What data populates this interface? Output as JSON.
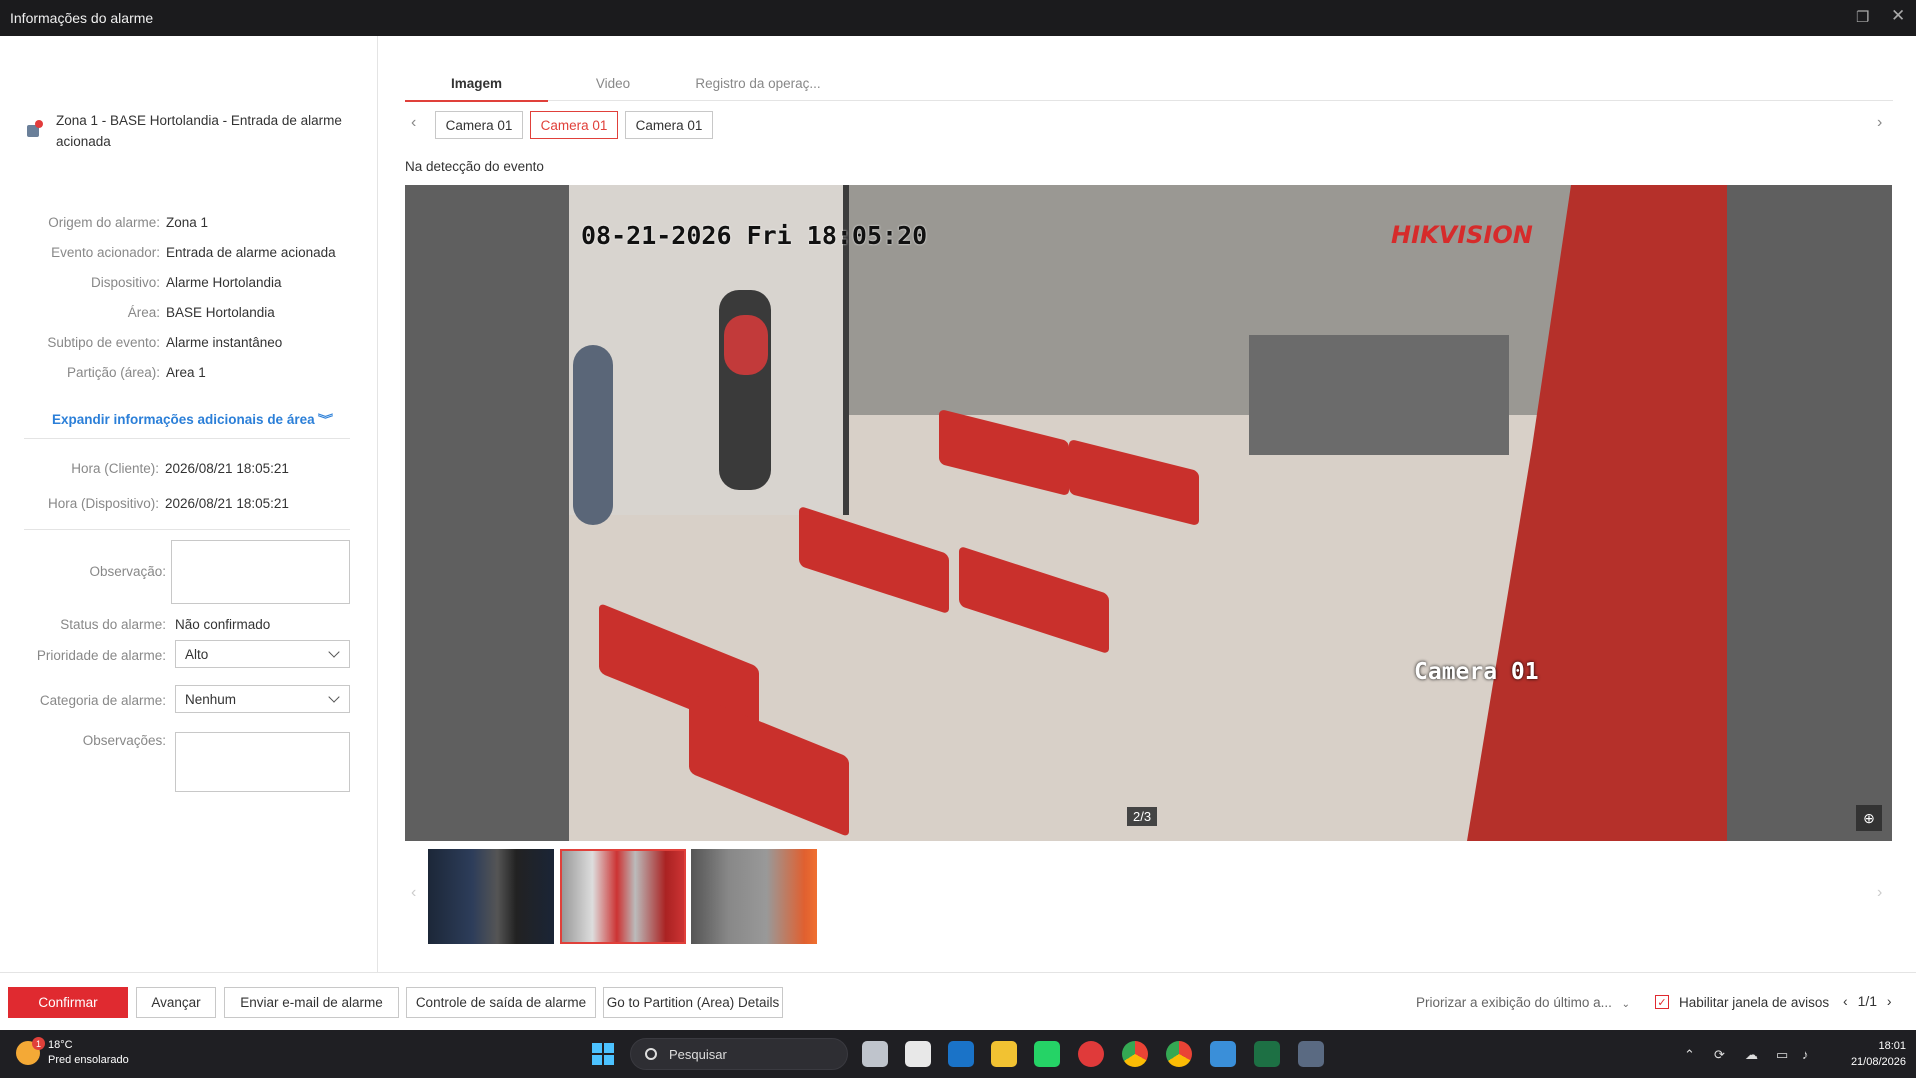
{
  "window": {
    "title": "Informações do alarme",
    "restore_icon": "restore-icon",
    "close_icon": "close-icon"
  },
  "alarm": {
    "header": "Zona 1 - BASE Hortolandia - Entrada de alarme acionada"
  },
  "details": [
    {
      "key": "Origem do alarme:",
      "value": "Zona 1"
    },
    {
      "key": "Evento acionador:",
      "value": "Entrada de alarme acionada"
    },
    {
      "key": "Dispositivo:",
      "value": "Alarme Hortolandia"
    },
    {
      "key": "Área:",
      "value": "BASE Hortolandia"
    },
    {
      "key": "Subtipo de evento:",
      "value": "Alarme instantâneo"
    },
    {
      "key": "Partição (área):",
      "value": "Area 1"
    }
  ],
  "expand_label": "Expandir informações adicionais de área",
  "times": [
    {
      "key": "Hora (Cliente):",
      "value": "2026/08/21 18:05:21"
    },
    {
      "key": "Hora (Dispositivo):",
      "value": "2026/08/21 18:05:21"
    }
  ],
  "form": {
    "observacao_label": "Observação:",
    "observacao_value": "",
    "status_label": "Status do alarme:",
    "status_value": "Não confirmado",
    "prioridade_label": "Prioridade de alarme:",
    "prioridade_value": "Alto",
    "categoria_label": "Categoria de alarme:",
    "categoria_value": "Nenhum",
    "observacoes_label": "Observações:",
    "observacoes_value": ""
  },
  "tabs": [
    "Imagem",
    "Video",
    "Registro da operaç..."
  ],
  "active_tab": 0,
  "cameras": [
    "Camera 01",
    "Camera 01",
    "Camera 01"
  ],
  "active_camera": 1,
  "event_label": "Na detecção do evento",
  "viewer": {
    "osd_time": "08-21-2026 Fri 18:05:20",
    "osd_brand": "HIKVISION",
    "osd_camera": "Camera 01",
    "page_indicator": "2/3"
  },
  "thumbnails": 3,
  "active_thumbnail": 1,
  "buttons": {
    "confirm": "Confirmar",
    "next": "Avançar",
    "email": "Enviar e-mail de alarme",
    "exit": "Controle de saída de alarme",
    "partition": "Go to Partition (Area) Details"
  },
  "priority_select": "Priorizar a exibição do último a...",
  "popup_checkbox": {
    "label": "Habilitar janela de avisos",
    "checked": true
  },
  "pager": "1/1",
  "taskbar": {
    "weather_temp": "18°C",
    "weather_text": "Pred ensolarado",
    "weather_badge": "1",
    "search_placeholder": "Pesquisar",
    "time": "18:01",
    "date": "21/08/2026"
  },
  "colors": {
    "accent": "#e02a30",
    "link": "#2b7fd8",
    "titlebar": "#1b1b1d",
    "taskbar": "#1f1f23"
  }
}
